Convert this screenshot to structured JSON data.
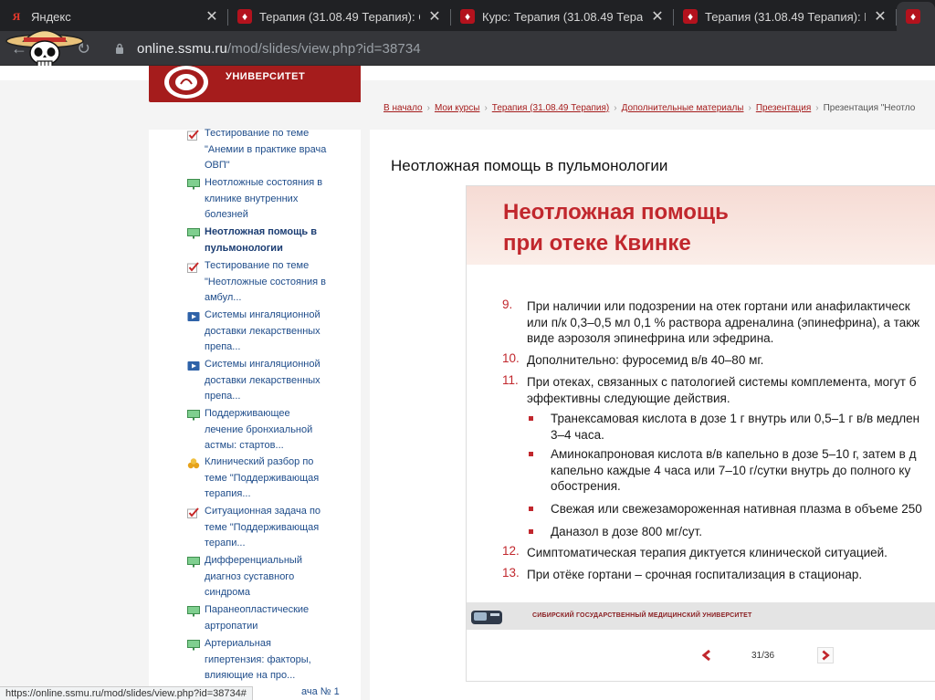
{
  "browser": {
    "tabs": [
      {
        "title": "Яндекс",
        "icon": "yandex-icon"
      },
      {
        "title": "Терапия (31.08.49 Терапия): С",
        "icon": "shield-icon"
      },
      {
        "title": "Курс: Терапия (31.08.49 Терап",
        "icon": "shield-icon"
      },
      {
        "title": "Терапия (31.08.49 Терапия): Н",
        "icon": "shield-icon"
      },
      {
        "title": "",
        "icon": "shield-icon"
      }
    ],
    "url_host": "online.ssmu.ru",
    "url_path": "/mod/slides/view.php?id=38734",
    "status_url": "https://online.ssmu.ru/mod/slides/view.php?id=38734#"
  },
  "site": {
    "logo_text": "УНИВЕРСИТЕТ",
    "accent_color": "#a51c1c"
  },
  "breadcrumb": {
    "items": [
      "В начало",
      "Мои курсы",
      "Терапия (31.08.49 Терапия)",
      "Дополнительные материалы",
      "Презентация"
    ],
    "current": "Презентация \"Неотло"
  },
  "sidebar": {
    "items": [
      {
        "lines": [
          "Тестирование по теме",
          "\"Анемии в практике врача",
          "ОВП\""
        ],
        "icon": "quiz-icon",
        "active": false
      },
      {
        "lines": [
          "Неотложные состояния в",
          "клинике внутренних",
          "болезней"
        ],
        "icon": "slides-icon",
        "active": false
      },
      {
        "lines": [
          "Неотложная помощь в",
          "пульмонологии"
        ],
        "icon": "slides-icon",
        "active": true
      },
      {
        "lines": [
          "Тестирование по теме",
          "\"Неотложные состояния в",
          "амбул..."
        ],
        "icon": "quiz-icon",
        "active": false
      },
      {
        "lines": [
          "Системы ингаляционной",
          "доставки лекарственных",
          "препа..."
        ],
        "icon": "video-icon",
        "active": false
      },
      {
        "lines": [
          "Системы ингаляционной",
          "доставки лекарственных",
          "препа..."
        ],
        "icon": "video-icon",
        "active": false
      },
      {
        "lines": [
          "Поддерживающее",
          "лечение бронхиальной",
          "астмы: стартов..."
        ],
        "icon": "slides-icon",
        "active": false
      },
      {
        "lines": [
          "Клинический разбор по",
          "теме \"Поддерживающая",
          "терапия..."
        ],
        "icon": "case-icon",
        "active": false
      },
      {
        "lines": [
          "Ситуационная задача по",
          "теме \"Поддерживающая",
          "терапи..."
        ],
        "icon": "quiz-icon",
        "active": false
      },
      {
        "lines": [
          "Дифференциальный",
          "диагноз суставного",
          "синдрома"
        ],
        "icon": "slides-icon",
        "active": false
      },
      {
        "lines": [
          "Паранеопластические",
          "артропатии"
        ],
        "icon": "slides-icon",
        "active": false
      },
      {
        "lines": [
          "Артериальная",
          "гипертензия: факторы,",
          "влияющие на про..."
        ],
        "icon": "slides-icon",
        "active": false
      }
    ],
    "peek_text": "ача № 1"
  },
  "main": {
    "title": "Неотложная помощь в пульмонологии"
  },
  "slide": {
    "title_line1": "Неотложная помощь",
    "title_line2": "при отеке Квинке",
    "items": [
      {
        "num": "9.",
        "lines": [
          "При наличии или подозрении на отек гортани или анафилактическ",
          "или п/к 0,3–0,5 мл 0,1 % раствора адреналина (эпинефрина), а такж",
          "виде аэрозоля эпинефрина или эфедрина."
        ]
      },
      {
        "num": "10.",
        "lines": [
          "Дополнительно: фуросемид в/в 40–80 мг."
        ]
      },
      {
        "num": "11.",
        "lines": [
          "При отеках, связанных с патологией системы комплемента, могут б",
          "эффективны следующие действия."
        ]
      },
      {
        "num": "12.",
        "lines": [
          "Симптоматическая терапия диктуется клинической ситуацией."
        ]
      },
      {
        "num": "13.",
        "lines": [
          "При отёке гортани – срочная госпитализация в стационар."
        ]
      }
    ],
    "bullets": [
      {
        "lines": [
          "Транексамовая кислота в дозе 1 г внутрь или 0,5–1 г в/в медлен",
          "3–4 часа."
        ]
      },
      {
        "lines": [
          "Аминокапроновая кислота в/в капельно в дозе 5–10 г, затем в д",
          "капельно каждые 4 часа или 7–10 г/сутки внутрь до полного ку",
          "обострения."
        ]
      },
      {
        "lines": [
          "Свежая или свежезамороженная нативная плазма в объеме 250"
        ]
      },
      {
        "lines": [
          "Даназол в дозе 800 мг/сут."
        ]
      }
    ],
    "footer_text": "СИБИРСКИЙ ГОСУДАРСТВЕННЫЙ МЕДИЦИНСКИЙ УНИВЕРСИТЕТ",
    "page_info": "31/36",
    "accent_color": "#c1272d"
  }
}
